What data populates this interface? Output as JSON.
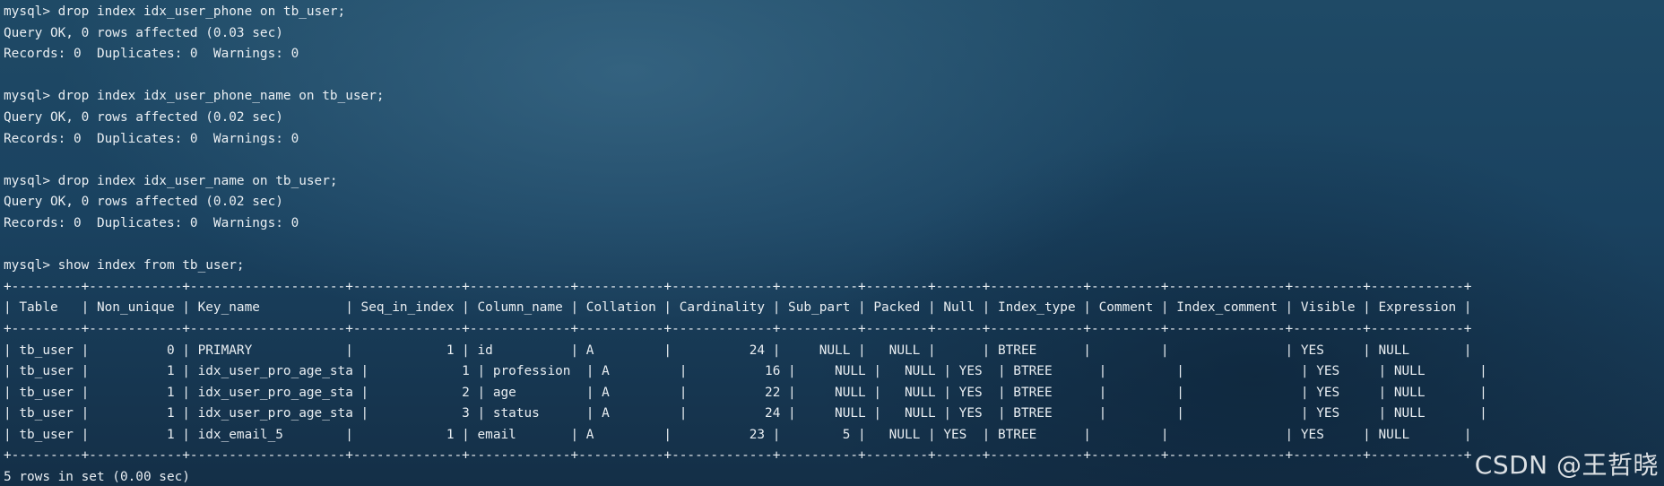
{
  "terminal": {
    "lines": [
      "mysql> drop index idx_user_phone on tb_user;",
      "Query OK, 0 rows affected (0.03 sec)",
      "Records: 0  Duplicates: 0  Warnings: 0",
      "",
      "mysql> drop index idx_user_phone_name on tb_user;",
      "Query OK, 0 rows affected (0.02 sec)",
      "Records: 0  Duplicates: 0  Warnings: 0",
      "",
      "mysql> drop index idx_user_name on tb_user;",
      "Query OK, 0 rows affected (0.02 sec)",
      "Records: 0  Duplicates: 0  Warnings: 0",
      "",
      "mysql> show index from tb_user;",
      "+---------+------------+--------------------+--------------+-------------+-----------+-------------+----------+--------+------+------------+---------+---------------+---------+------------+",
      "| Table   | Non_unique | Key_name           | Seq_in_index | Column_name | Collation | Cardinality | Sub_part | Packed | Null | Index_type | Comment | Index_comment | Visible | Expression |",
      "+---------+------------+--------------------+--------------+-------------+-----------+-------------+----------+--------+------+------------+---------+---------------+---------+------------+",
      "| tb_user |          0 | PRIMARY            |            1 | id          | A         |          24 |     NULL |   NULL |      | BTREE      |         |               | YES     | NULL       |",
      "| tb_user |          1 | idx_user_pro_age_sta |            1 | profession  | A         |          16 |     NULL |   NULL | YES  | BTREE      |         |               | YES     | NULL       |",
      "| tb_user |          1 | idx_user_pro_age_sta |            2 | age         | A         |          22 |     NULL |   NULL | YES  | BTREE      |         |               | YES     | NULL       |",
      "| tb_user |          1 | idx_user_pro_age_sta |            3 | status      | A         |          24 |     NULL |   NULL | YES  | BTREE      |         |               | YES     | NULL       |",
      "| tb_user |          1 | idx_email_5        |            1 | email       | A         |          23 |        5 |   NULL | YES  | BTREE      |         |               | YES     | NULL       |",
      "+---------+------------+--------------------+--------------+-------------+-----------+-------------+----------+--------+------+------------+---------+---------------+---------+------------+",
      "5 rows in set (0.00 sec)"
    ]
  },
  "watermark": {
    "text": "CSDN @王哲晓"
  }
}
